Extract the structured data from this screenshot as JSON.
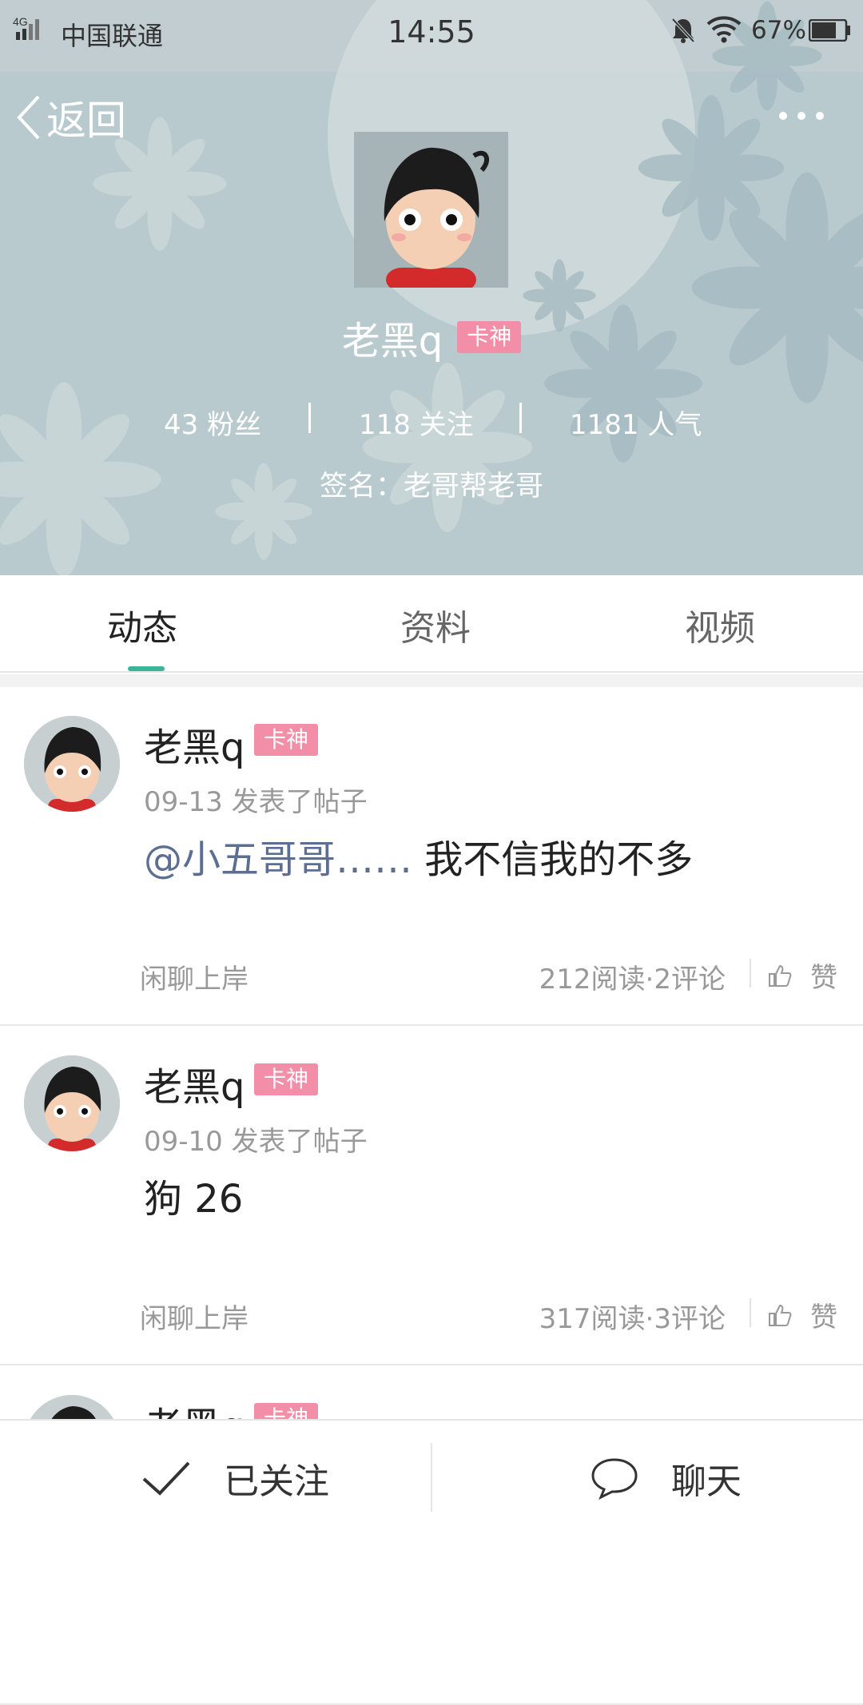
{
  "status_bar": {
    "network": "4G",
    "carrier": "中国联通",
    "time": "14:55",
    "battery_percent": "67%",
    "icons": [
      "signal-icon",
      "bell-muted-icon",
      "wifi-icon",
      "battery-icon"
    ]
  },
  "nav": {
    "back_label": "返回",
    "more_icon": "more-icon"
  },
  "profile": {
    "name": "老黑q",
    "badge": "卡神",
    "stats": {
      "fans": "43 粉丝",
      "following": "118 关注",
      "popularity": "1181 人气"
    },
    "signature": "签名：老哥帮老哥"
  },
  "tabs": [
    {
      "label": "动态",
      "active": true
    },
    {
      "label": "资料",
      "active": false
    },
    {
      "label": "视频",
      "active": false
    }
  ],
  "posts": [
    {
      "author": "老黑q",
      "badge": "卡神",
      "meta": "09-13 发表了帖子",
      "mention": "@小五哥哥……",
      "content": "我不信我的不多",
      "forum": "闲聊上岸",
      "counts": "212阅读·2评论",
      "like_label": "赞"
    },
    {
      "author": "老黑q",
      "badge": "卡神",
      "meta": "09-10 发表了帖子",
      "mention": "",
      "content": "狗 26",
      "forum": "闲聊上岸",
      "counts": "317阅读·3评论",
      "like_label": "赞"
    },
    {
      "author": "老黑q",
      "badge": "卡神"
    }
  ],
  "bottom_bar": {
    "follow_label": "已关注",
    "chat_label": "聊天"
  },
  "colors": {
    "header_bg": "#b8c9cf",
    "badge": "#f38ea8",
    "tab_indicator": "#3bb59a",
    "mention": "#5c6f93"
  }
}
